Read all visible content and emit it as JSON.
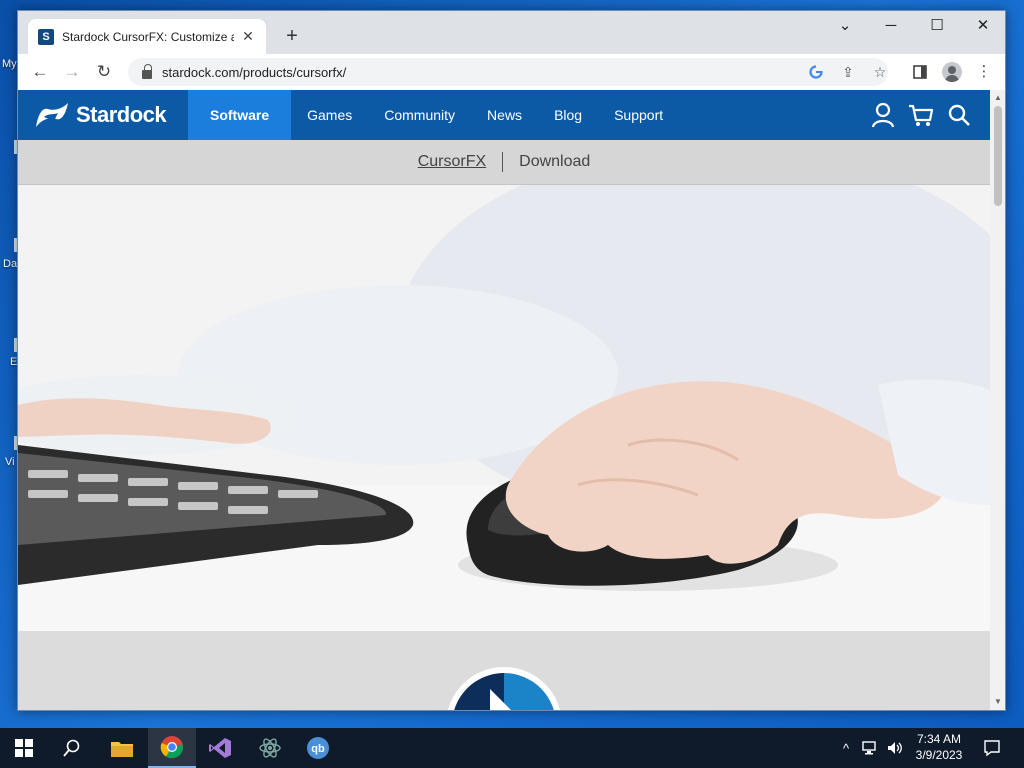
{
  "desktop": {
    "labels": [
      "My",
      "Da",
      "E",
      "Vi"
    ]
  },
  "browser": {
    "tab": {
      "title": "Stardock CursorFX: Customize ar",
      "favicon": "stardock-favicon"
    },
    "address": "stardock.com/products/cursorfx/",
    "window_controls": {
      "minimize": "─",
      "maximize": "☐",
      "close": "✕",
      "tab_search": "⌄"
    }
  },
  "site": {
    "brand": "Stardock",
    "nav": [
      {
        "label": "Software",
        "active": true
      },
      {
        "label": "Games"
      },
      {
        "label": "Community"
      },
      {
        "label": "News"
      },
      {
        "label": "Blog"
      },
      {
        "label": "Support"
      }
    ],
    "nav_icons": [
      "account-icon",
      "cart-icon",
      "search-icon"
    ],
    "subnav": {
      "product": "CursorFX",
      "download": "Download"
    },
    "colors": {
      "nav_bg": "#0c5aa6",
      "nav_active": "#1b7ddc",
      "subnav_bg": "#d6d6d6"
    }
  },
  "taskbar": {
    "apps": [
      "start-icon",
      "search-icon",
      "file-explorer-icon",
      "chrome-icon",
      "visual-studio-icon",
      "atom-icon",
      "qbittorrent-icon"
    ],
    "clock": {
      "time": "7:34 AM",
      "date": "3/9/2023"
    }
  }
}
